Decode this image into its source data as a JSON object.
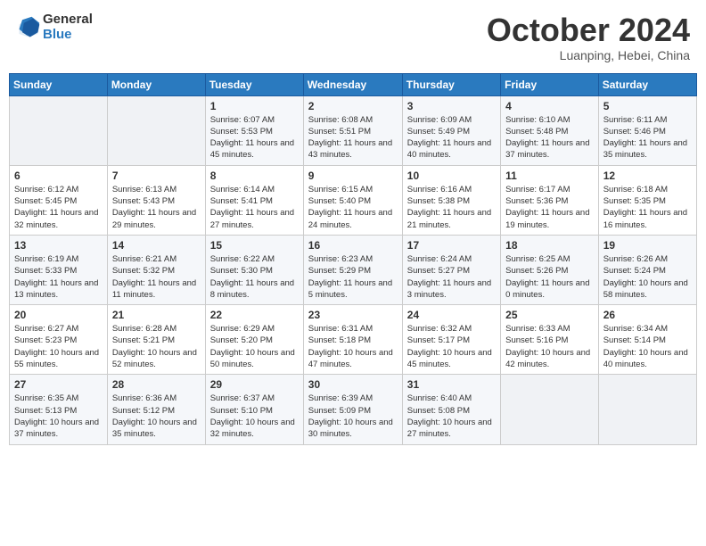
{
  "header": {
    "logo_general": "General",
    "logo_blue": "Blue",
    "month_title": "October 2024",
    "subtitle": "Luanping, Hebei, China"
  },
  "weekdays": [
    "Sunday",
    "Monday",
    "Tuesday",
    "Wednesday",
    "Thursday",
    "Friday",
    "Saturday"
  ],
  "weeks": [
    [
      {
        "day": "",
        "sunrise": "",
        "sunset": "",
        "daylight": ""
      },
      {
        "day": "",
        "sunrise": "",
        "sunset": "",
        "daylight": ""
      },
      {
        "day": "1",
        "sunrise": "Sunrise: 6:07 AM",
        "sunset": "Sunset: 5:53 PM",
        "daylight": "Daylight: 11 hours and 45 minutes."
      },
      {
        "day": "2",
        "sunrise": "Sunrise: 6:08 AM",
        "sunset": "Sunset: 5:51 PM",
        "daylight": "Daylight: 11 hours and 43 minutes."
      },
      {
        "day": "3",
        "sunrise": "Sunrise: 6:09 AM",
        "sunset": "Sunset: 5:49 PM",
        "daylight": "Daylight: 11 hours and 40 minutes."
      },
      {
        "day": "4",
        "sunrise": "Sunrise: 6:10 AM",
        "sunset": "Sunset: 5:48 PM",
        "daylight": "Daylight: 11 hours and 37 minutes."
      },
      {
        "day": "5",
        "sunrise": "Sunrise: 6:11 AM",
        "sunset": "Sunset: 5:46 PM",
        "daylight": "Daylight: 11 hours and 35 minutes."
      }
    ],
    [
      {
        "day": "6",
        "sunrise": "Sunrise: 6:12 AM",
        "sunset": "Sunset: 5:45 PM",
        "daylight": "Daylight: 11 hours and 32 minutes."
      },
      {
        "day": "7",
        "sunrise": "Sunrise: 6:13 AM",
        "sunset": "Sunset: 5:43 PM",
        "daylight": "Daylight: 11 hours and 29 minutes."
      },
      {
        "day": "8",
        "sunrise": "Sunrise: 6:14 AM",
        "sunset": "Sunset: 5:41 PM",
        "daylight": "Daylight: 11 hours and 27 minutes."
      },
      {
        "day": "9",
        "sunrise": "Sunrise: 6:15 AM",
        "sunset": "Sunset: 5:40 PM",
        "daylight": "Daylight: 11 hours and 24 minutes."
      },
      {
        "day": "10",
        "sunrise": "Sunrise: 6:16 AM",
        "sunset": "Sunset: 5:38 PM",
        "daylight": "Daylight: 11 hours and 21 minutes."
      },
      {
        "day": "11",
        "sunrise": "Sunrise: 6:17 AM",
        "sunset": "Sunset: 5:36 PM",
        "daylight": "Daylight: 11 hours and 19 minutes."
      },
      {
        "day": "12",
        "sunrise": "Sunrise: 6:18 AM",
        "sunset": "Sunset: 5:35 PM",
        "daylight": "Daylight: 11 hours and 16 minutes."
      }
    ],
    [
      {
        "day": "13",
        "sunrise": "Sunrise: 6:19 AM",
        "sunset": "Sunset: 5:33 PM",
        "daylight": "Daylight: 11 hours and 13 minutes."
      },
      {
        "day": "14",
        "sunrise": "Sunrise: 6:21 AM",
        "sunset": "Sunset: 5:32 PM",
        "daylight": "Daylight: 11 hours and 11 minutes."
      },
      {
        "day": "15",
        "sunrise": "Sunrise: 6:22 AM",
        "sunset": "Sunset: 5:30 PM",
        "daylight": "Daylight: 11 hours and 8 minutes."
      },
      {
        "day": "16",
        "sunrise": "Sunrise: 6:23 AM",
        "sunset": "Sunset: 5:29 PM",
        "daylight": "Daylight: 11 hours and 5 minutes."
      },
      {
        "day": "17",
        "sunrise": "Sunrise: 6:24 AM",
        "sunset": "Sunset: 5:27 PM",
        "daylight": "Daylight: 11 hours and 3 minutes."
      },
      {
        "day": "18",
        "sunrise": "Sunrise: 6:25 AM",
        "sunset": "Sunset: 5:26 PM",
        "daylight": "Daylight: 11 hours and 0 minutes."
      },
      {
        "day": "19",
        "sunrise": "Sunrise: 6:26 AM",
        "sunset": "Sunset: 5:24 PM",
        "daylight": "Daylight: 10 hours and 58 minutes."
      }
    ],
    [
      {
        "day": "20",
        "sunrise": "Sunrise: 6:27 AM",
        "sunset": "Sunset: 5:23 PM",
        "daylight": "Daylight: 10 hours and 55 minutes."
      },
      {
        "day": "21",
        "sunrise": "Sunrise: 6:28 AM",
        "sunset": "Sunset: 5:21 PM",
        "daylight": "Daylight: 10 hours and 52 minutes."
      },
      {
        "day": "22",
        "sunrise": "Sunrise: 6:29 AM",
        "sunset": "Sunset: 5:20 PM",
        "daylight": "Daylight: 10 hours and 50 minutes."
      },
      {
        "day": "23",
        "sunrise": "Sunrise: 6:31 AM",
        "sunset": "Sunset: 5:18 PM",
        "daylight": "Daylight: 10 hours and 47 minutes."
      },
      {
        "day": "24",
        "sunrise": "Sunrise: 6:32 AM",
        "sunset": "Sunset: 5:17 PM",
        "daylight": "Daylight: 10 hours and 45 minutes."
      },
      {
        "day": "25",
        "sunrise": "Sunrise: 6:33 AM",
        "sunset": "Sunset: 5:16 PM",
        "daylight": "Daylight: 10 hours and 42 minutes."
      },
      {
        "day": "26",
        "sunrise": "Sunrise: 6:34 AM",
        "sunset": "Sunset: 5:14 PM",
        "daylight": "Daylight: 10 hours and 40 minutes."
      }
    ],
    [
      {
        "day": "27",
        "sunrise": "Sunrise: 6:35 AM",
        "sunset": "Sunset: 5:13 PM",
        "daylight": "Daylight: 10 hours and 37 minutes."
      },
      {
        "day": "28",
        "sunrise": "Sunrise: 6:36 AM",
        "sunset": "Sunset: 5:12 PM",
        "daylight": "Daylight: 10 hours and 35 minutes."
      },
      {
        "day": "29",
        "sunrise": "Sunrise: 6:37 AM",
        "sunset": "Sunset: 5:10 PM",
        "daylight": "Daylight: 10 hours and 32 minutes."
      },
      {
        "day": "30",
        "sunrise": "Sunrise: 6:39 AM",
        "sunset": "Sunset: 5:09 PM",
        "daylight": "Daylight: 10 hours and 30 minutes."
      },
      {
        "day": "31",
        "sunrise": "Sunrise: 6:40 AM",
        "sunset": "Sunset: 5:08 PM",
        "daylight": "Daylight: 10 hours and 27 minutes."
      },
      {
        "day": "",
        "sunrise": "",
        "sunset": "",
        "daylight": ""
      },
      {
        "day": "",
        "sunrise": "",
        "sunset": "",
        "daylight": ""
      }
    ]
  ]
}
